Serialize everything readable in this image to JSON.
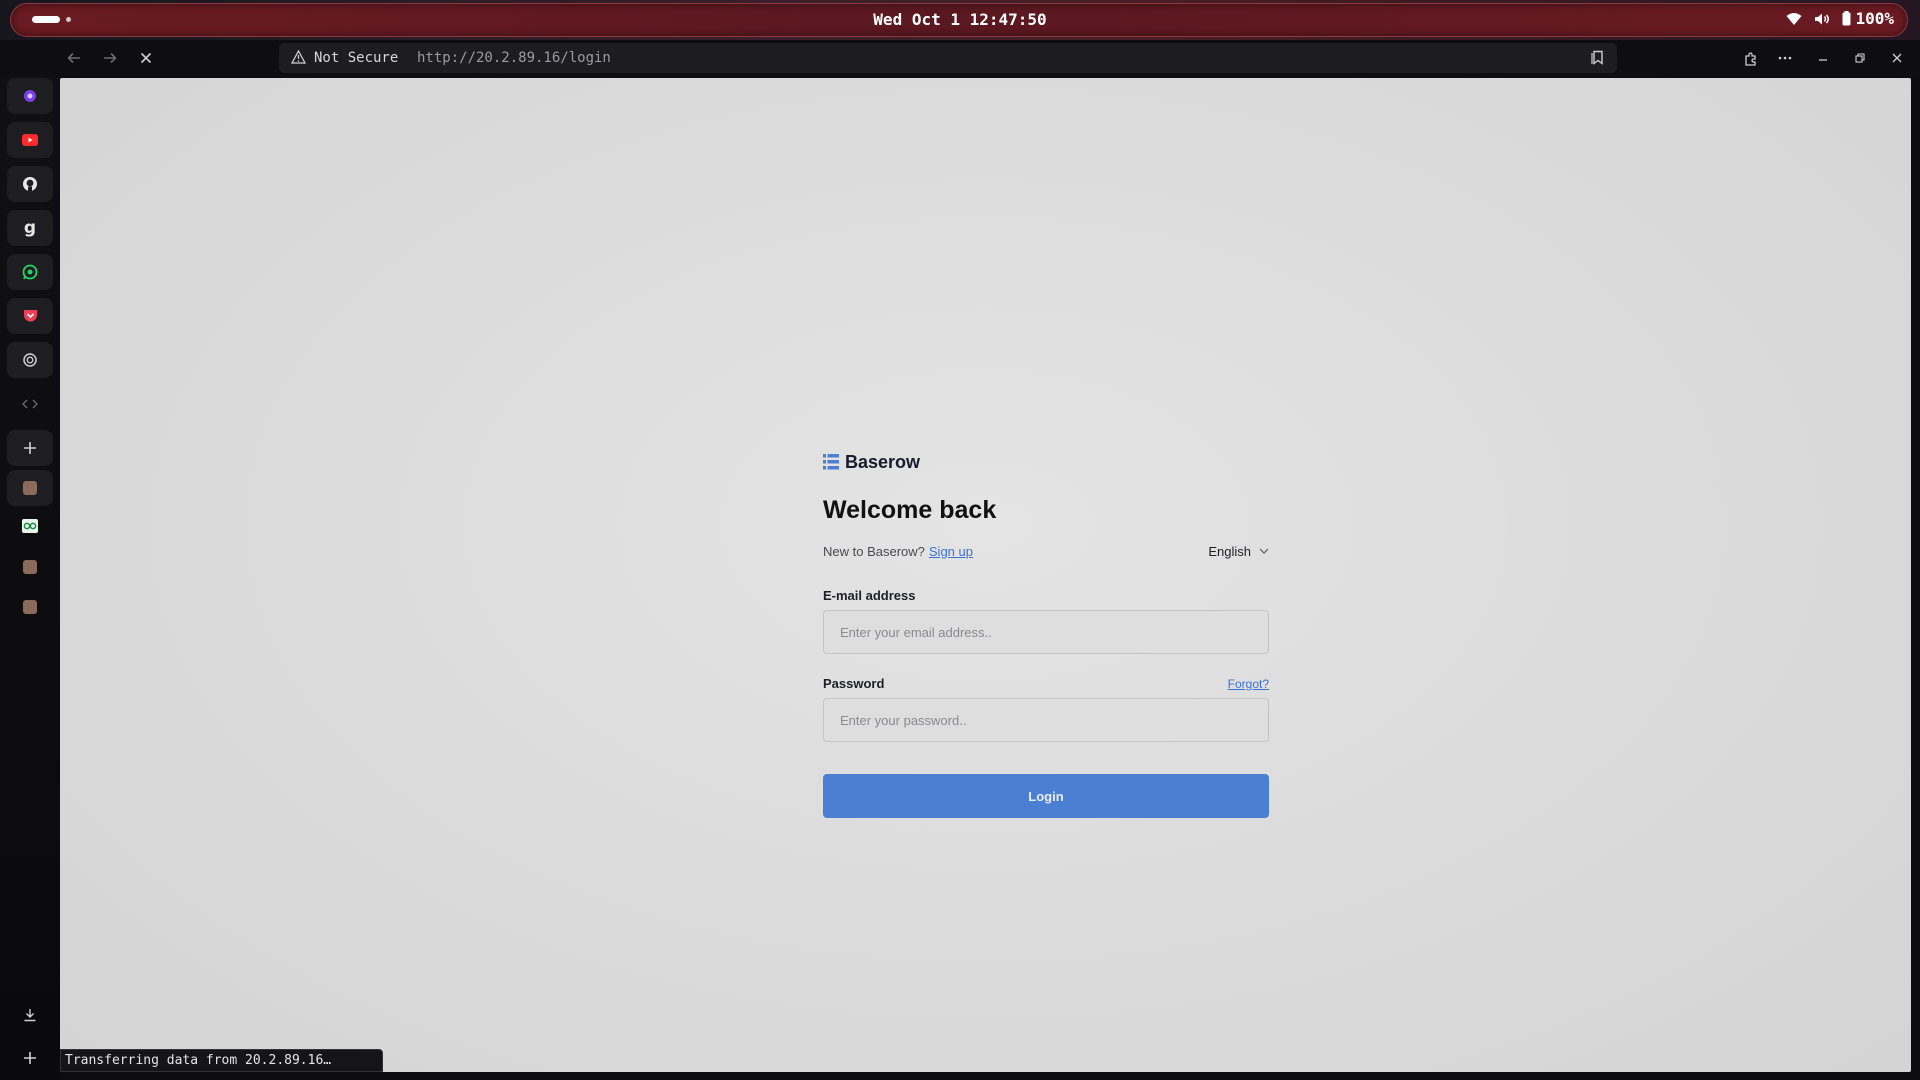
{
  "system_bar": {
    "clock": "Wed Oct 1 12:47:50",
    "battery": "100%",
    "icons": [
      "wifi-icon",
      "volume-icon",
      "battery-icon"
    ]
  },
  "browser": {
    "security_label": "Not Secure",
    "url": "http://20.2.89.16/login",
    "nav_icons": [
      "back-arrow-icon",
      "forward-arrow-icon",
      "stop-loading-icon"
    ],
    "window_icons": [
      "extensions-icon",
      "more-icon",
      "minimize-icon",
      "restore-icon",
      "close-icon"
    ],
    "status_text": "Transferring data from 20.2.89.16…"
  },
  "sidebar": {
    "items": [
      {
        "name": "tor-icon",
        "color": "#7b3fe4"
      },
      {
        "name": "youtube-icon",
        "color": "#ff2a2a"
      },
      {
        "name": "github-icon",
        "color": "#e6e6e6"
      },
      {
        "name": "gmail-g-icon",
        "color": "#e6e6e6"
      },
      {
        "name": "whatsapp-icon",
        "color": "#25d366"
      },
      {
        "name": "pocket-icon",
        "color": "#ef3e56"
      },
      {
        "name": "chatgpt-icon",
        "color": "#cfcfcf"
      },
      {
        "name": "code-icon",
        "color": "#6a6a70"
      },
      {
        "name": "add-icon",
        "color": "#cfcfcf"
      }
    ],
    "bottom_icons": [
      "download-icon",
      "new-tab-icon"
    ]
  },
  "login": {
    "brand": "Baserow",
    "title": "Welcome back",
    "new_text": "New to Baserow?",
    "signup_link": "Sign up",
    "language": "English",
    "email_label": "E-mail address",
    "email_placeholder": "Enter your email address..",
    "password_label": "Password",
    "forgot_link": "Forgot?",
    "password_placeholder": "Enter your password..",
    "login_button": "Login",
    "accent_color": "#4a7fd4"
  }
}
